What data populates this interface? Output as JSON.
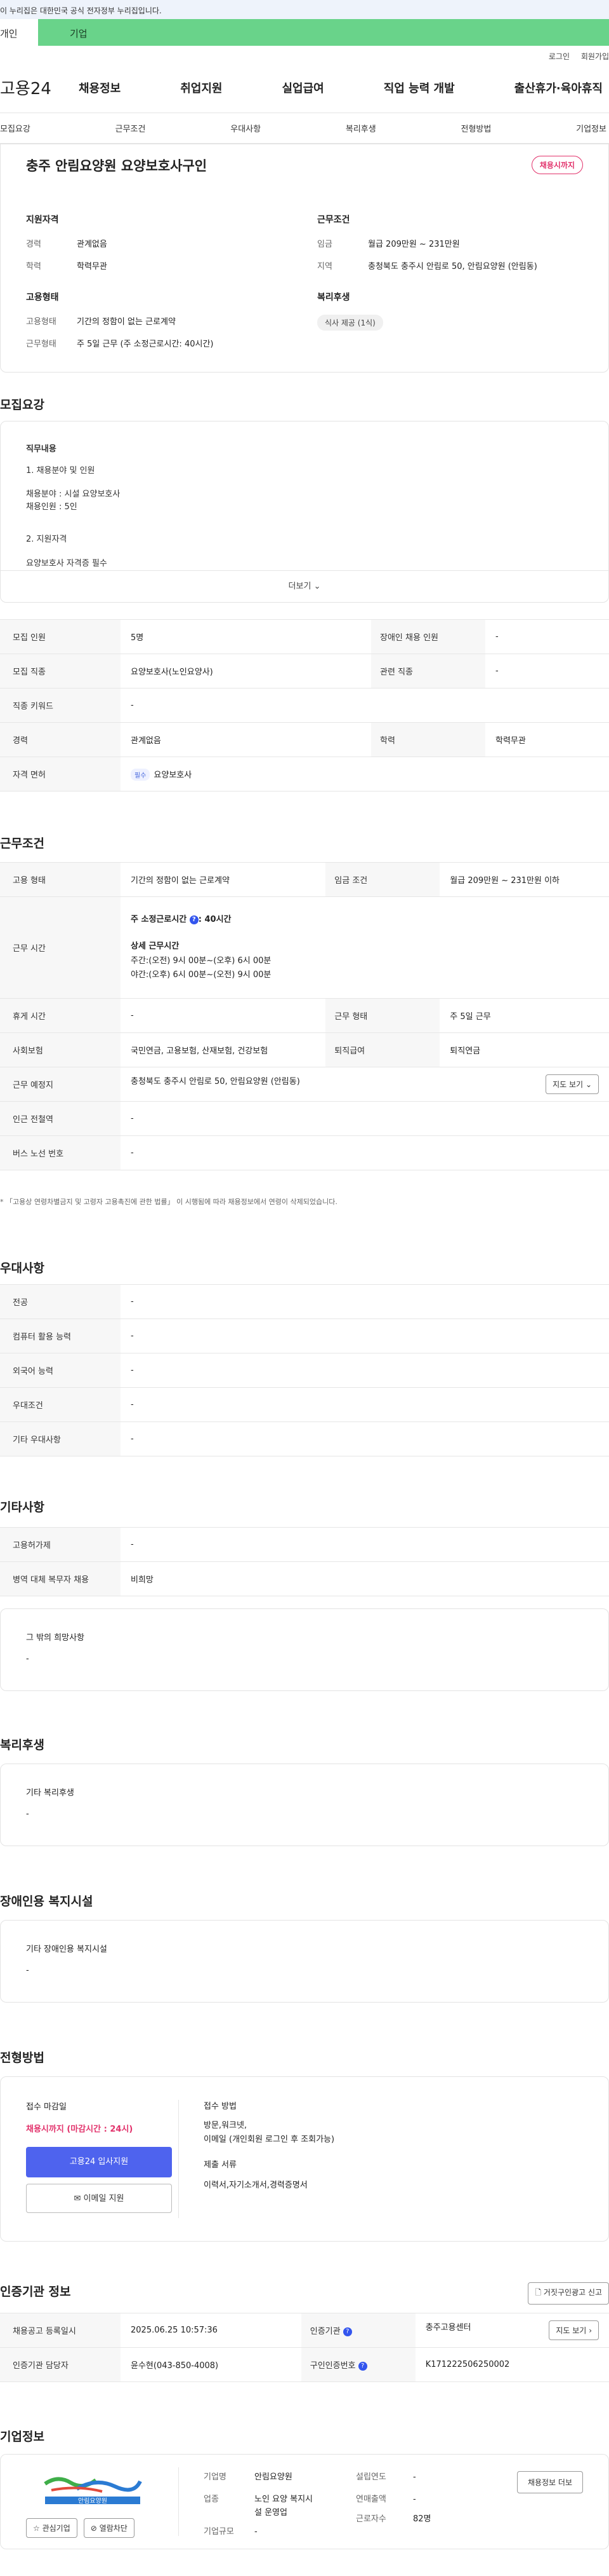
{
  "banner": {
    "text": "이 누리집은 대한민국 공식 전자정부 누리집입니다."
  },
  "top_tabs": {
    "personal": "개인",
    "corporate": "기업"
  },
  "util": {
    "login": "로그인",
    "join": "회원가입"
  },
  "gnb": {
    "logo": "고용24",
    "menu": [
      "채용정보",
      "취업지원",
      "실업급여",
      "직업 능력 개발",
      "출산휴가·육아휴직"
    ]
  },
  "anchor": [
    "모집요강",
    "근무조건",
    "우대사항",
    "복리후생",
    "전형방법",
    "기업정보"
  ],
  "summary": {
    "title": "충주 안림요양원 요양보호사구인",
    "status": "채용시까지",
    "qualification": {
      "heading": "지원자격",
      "rows": [
        {
          "k": "경력",
          "v": "관계없음"
        },
        {
          "k": "학력",
          "v": "학력무관"
        }
      ]
    },
    "condition": {
      "heading": "근무조건",
      "rows": [
        {
          "k": "임금",
          "v": "월급 209만원 ~ 231만원"
        },
        {
          "k": "지역",
          "v": "충청북도 충주시 안림로 50, 안림요양원 (안림동)"
        }
      ]
    },
    "employment": {
      "heading": "고용형태",
      "rows": [
        {
          "k": "고용형태",
          "v": "기간의 정함이 없는 근로계약"
        },
        {
          "k": "근무형태",
          "v": "주 5일 근무 (주 소정근로시간: 40시간)"
        }
      ]
    },
    "welfare": {
      "heading": "복리후생",
      "chip": "식사 제공 (1식)"
    }
  },
  "recruit": {
    "title": "모집요강",
    "duty_heading": "직무내용",
    "duty_lines": [
      "1. 채용분야 및 인원",
      "채용분야 : 시설 요양보호사",
      "채용인원 : 5인",
      "2. 지원자격",
      "요양보호사 자격증 필수"
    ],
    "more": "더보기",
    "table": {
      "r1": {
        "k1": "모집 인원",
        "v1": "5명",
        "k2": "장애인 채용 인원",
        "v2": "-"
      },
      "r2": {
        "k1": "모집 직종",
        "v1": "요양보호사(노인요양사)",
        "k2": "관련 직종",
        "v2": "-"
      },
      "r3": {
        "k1": "직종 키워드",
        "v1": "-"
      },
      "r4": {
        "k1": "경력",
        "v1": "관계없음",
        "k2": "학력",
        "v2": "학력무관"
      },
      "r5": {
        "k1": "자격 면허",
        "pill": "필수",
        "v1": "요양보호사"
      }
    }
  },
  "work": {
    "title": "근무조건",
    "r1": {
      "k1": "고용 형태",
      "v1": "기간의 정함이 없는 근로계약",
      "k2": "임금 조건",
      "v2": "월급 209만원 ~ 231만원 이하"
    },
    "hours": {
      "k": "근무 시간",
      "weekly": "주 소정근로시간",
      "weekly_val": ": 40시간",
      "detail": "상세 근무시간",
      "day": "주간:(오전) 9시 00분~(오후) 6시 00분",
      "night": "야간:(오후) 6시 00분~(오전) 9시 00분"
    },
    "r3": {
      "k1": "휴게 시간",
      "v1": "-",
      "k2": "근무 형태",
      "v2": "주 5일 근무"
    },
    "r4": {
      "k1": "사회보험",
      "v1": "국민연금, 고용보험, 산재보험, 건강보험",
      "k2": "퇴직급여",
      "v2": "퇴직연금"
    },
    "r5": {
      "k1": "근무 예정지",
      "v1": "충청북도 충주시 안림로 50, 안림요양원 (안림동)",
      "btn": "지도 보기"
    },
    "r6": {
      "k1": "인근 전철역",
      "v1": "-"
    },
    "r7": {
      "k1": "버스 노선 번호",
      "v1": "-"
    },
    "note": "* 「고용상 연령차별금지 및 고령자 고용촉진에 관한 법률」 이 시행됨에 따라 채용정보에서 연령이 삭제되었습니다."
  },
  "pref": {
    "title": "우대사항",
    "rows": [
      {
        "k": "전공",
        "v": "-"
      },
      {
        "k": "컴퓨터 활용 능력",
        "v": "-"
      },
      {
        "k": "외국어 능력",
        "v": "-"
      },
      {
        "k": "우대조건",
        "v": "-"
      },
      {
        "k": "기타 우대사항",
        "v": "-"
      }
    ]
  },
  "etc": {
    "title": "기타사항",
    "rows": [
      {
        "k": "고용허가제",
        "v": "-"
      },
      {
        "k": "병역 대체 복무자 채용",
        "v": "비희망"
      }
    ],
    "box_heading": "그 밖의 희망사항",
    "box_val": "-"
  },
  "welfare": {
    "title": "복리후생",
    "box_heading": "기타 복리후생",
    "box_val": "-"
  },
  "disabled": {
    "title": "장애인용 복지시설",
    "box_heading": "기타 장애인용 복지시설",
    "box_val": "-"
  },
  "selection": {
    "title": "전형방법",
    "deadline_label": "접수 마감일",
    "deadline_val": "채용시까지 (마감시간 : 24시)",
    "apply_btn": "고용24 입사지원",
    "email_btn": "이메일 지원",
    "method_label": "접수 방법",
    "method_val1": "방문,워크넷,",
    "method_val2": "이메일 (개인회원 로그인 후 조회가능)",
    "docs_label": "제출 서류",
    "docs_val": "이력서,자기소개서,경력증명서"
  },
  "cert": {
    "title": "인증기관 정보",
    "report_btn": "거짓구인광고 신고",
    "r1": {
      "k1": "채용공고 등록일시",
      "v1": "2025.06.25 10:57:36",
      "k2": "인증기관",
      "v2": "충주고용센터",
      "btn": "지도 보기"
    },
    "r2": {
      "k1": "인증기관 담당자",
      "v1": "윤수현(043-850-4008)",
      "k2": "구인인증번호",
      "v2": "K171222506250002"
    }
  },
  "company": {
    "title": "기업정보",
    "logo_text": "안림요양원",
    "fav_btn": "관심기업",
    "block_btn": "열람차단",
    "name_k": "기업명",
    "name_v": "안림요양원",
    "industry_k": "업종",
    "industry_v1": "노인 요양 복지시",
    "industry_v2": "설 운영업",
    "size_k": "기업규모",
    "size_v": "-",
    "founded_k": "설립연도",
    "founded_v": "-",
    "sales_k": "연매출액",
    "sales_v": "-",
    "workers_k": "근로자수",
    "workers_v": "82명",
    "jobs_btn": "채용정보 더보"
  }
}
